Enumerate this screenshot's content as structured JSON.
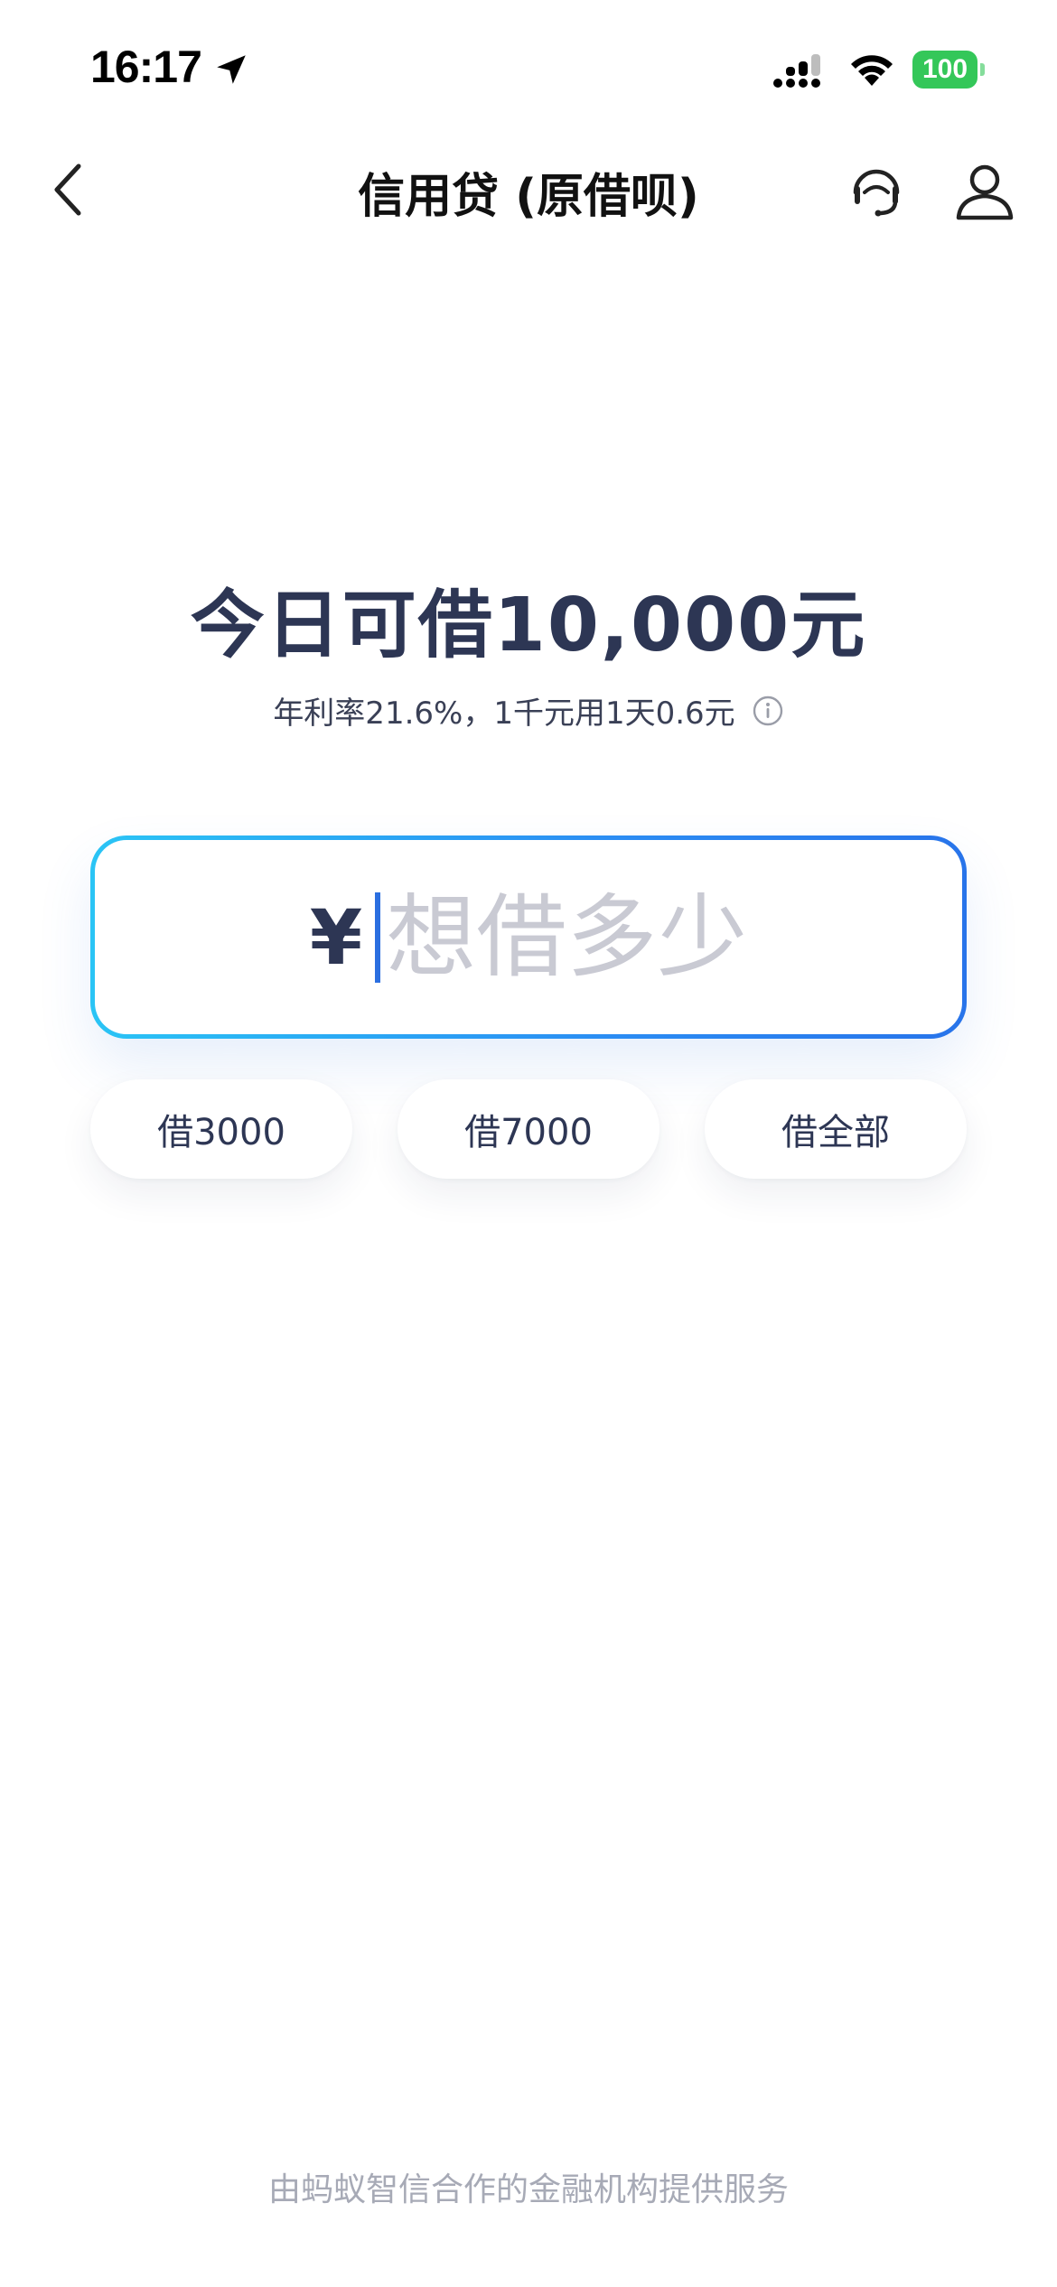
{
  "status_bar": {
    "time": "16:17",
    "battery": "100"
  },
  "nav": {
    "title": "信用贷 (原借呗)"
  },
  "main": {
    "headline": "今日可借10,000元",
    "rate_text": "年利率21.6%，1千元用1天0.6元",
    "currency_symbol": "¥",
    "amount_placeholder": "想借多少",
    "amount_value": "",
    "quick_options": [
      {
        "label": "借3000"
      },
      {
        "label": "借7000"
      },
      {
        "label": "借全部"
      }
    ]
  },
  "footer": {
    "note": "由蚂蚁智信合作的金融机构提供服务"
  },
  "colors": {
    "title_navy": "#2d3654",
    "input_border_start": "#2ac4f5",
    "input_border_end": "#2874ea",
    "battery_green": "#34c759",
    "footer_gray": "#a7aab6"
  }
}
